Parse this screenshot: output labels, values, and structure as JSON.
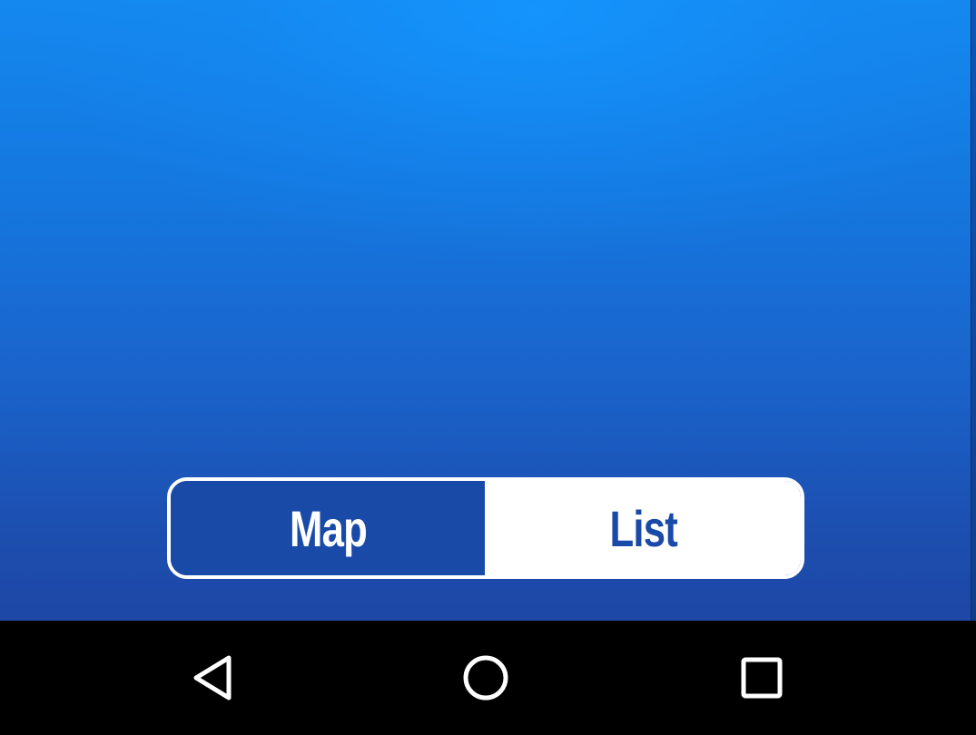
{
  "segmented_control": {
    "map_label": "Map",
    "list_label": "List",
    "selected": "Map"
  },
  "colors": {
    "background_top": "#1488ee",
    "background_bottom": "#1e47a6",
    "selected_segment": "#1a4aa8",
    "unselected_segment": "#ffffff",
    "nav_bar": "#000000",
    "nav_icon": "#ffffff"
  },
  "navigation_bar": {
    "icons": [
      "back-icon",
      "home-icon",
      "recents-icon"
    ]
  }
}
